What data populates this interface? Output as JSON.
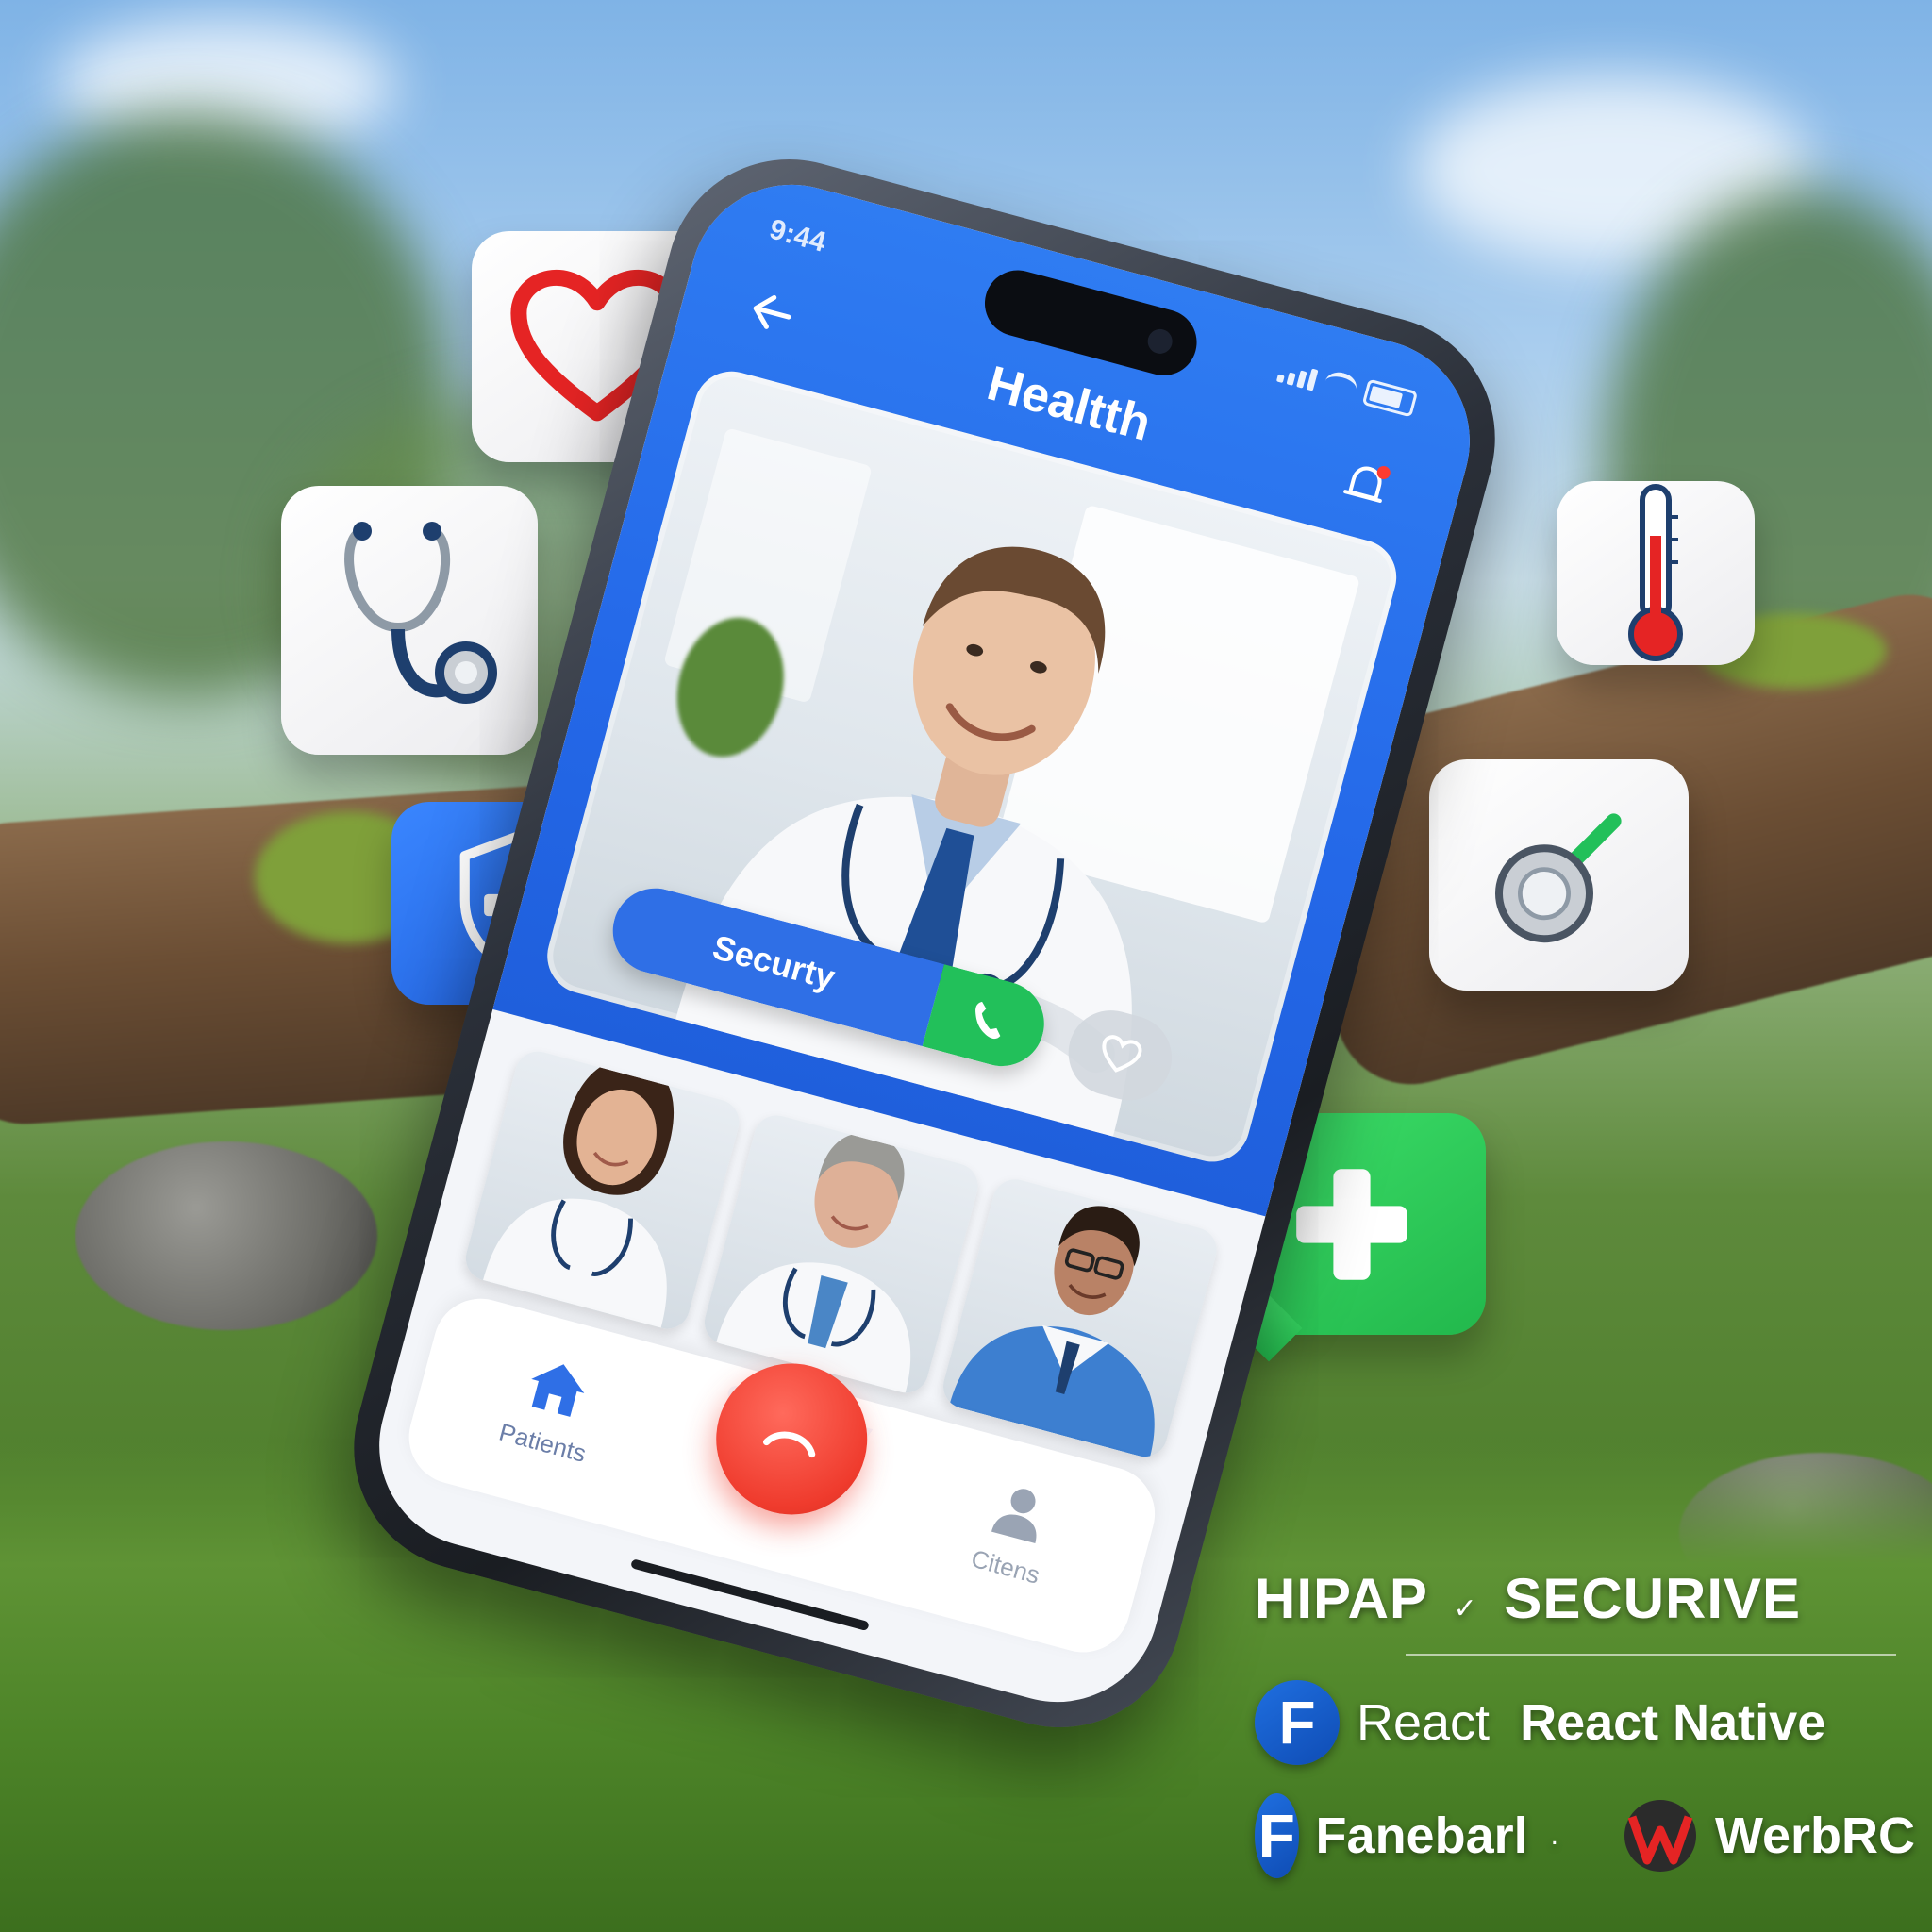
{
  "phone": {
    "status_time": "9:44",
    "app_title": "Healtth",
    "back_icon": "arrow-left-icon",
    "notification_icon": "bell-icon",
    "call_pill_label": "Securty",
    "call_button_icon": "phone-icon",
    "extra_button_icon": "heart-outline-icon",
    "caption": "Securty",
    "tabs": [
      {
        "label": "Patients",
        "icon": "home-icon"
      },
      {
        "label": "Citens",
        "icon": "person-icon"
      }
    ],
    "end_call_icon": "phone-hangup-icon"
  },
  "floating_icons": [
    "heart-icon",
    "stethoscope-icon",
    "shield-plus-icon",
    "thermometer-icon",
    "stethoscope-chestpiece-icon",
    "medical-plus-icon"
  ],
  "badges": {
    "headline_left": "HIPAP",
    "headline_mark": "✓",
    "headline_right": "SECURIVE",
    "row1_left": "React",
    "row1_right": "React Native",
    "row1_logo": "F",
    "row2_text": "Fanebarl",
    "row2_logo": "F",
    "row2_dot": ".",
    "row2_brand": "WerbRC"
  },
  "colors": {
    "primary_blue": "#2468e8",
    "call_green": "#22c05a",
    "end_call_red": "#ef3b2d",
    "tile_green": "#2ecc55"
  }
}
